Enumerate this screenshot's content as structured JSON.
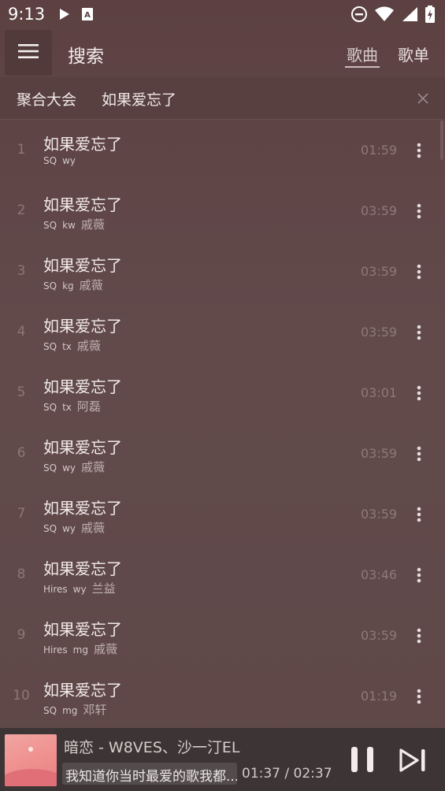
{
  "status_bar": {
    "time": "9:13",
    "icons": [
      "play-icon",
      "sim-card-a-icon",
      "do-not-disturb-icon",
      "wifi-icon",
      "signal-icon",
      "battery-charging-icon"
    ]
  },
  "header": {
    "title": "搜索",
    "tabs": [
      {
        "label": "歌曲",
        "active": true
      },
      {
        "label": "歌单",
        "active": false
      }
    ]
  },
  "search": {
    "source": "聚合大会",
    "query": "如果爱忘了"
  },
  "results": [
    {
      "index": "1",
      "title": "如果爱忘了",
      "quality": "SQ",
      "source": "wy",
      "artist": "",
      "duration": "01:59"
    },
    {
      "index": "2",
      "title": "如果爱忘了",
      "quality": "SQ",
      "source": "kw",
      "artist": "戚薇",
      "duration": "03:59"
    },
    {
      "index": "3",
      "title": "如果爱忘了",
      "quality": "SQ",
      "source": "kg",
      "artist": "戚薇",
      "duration": "03:59"
    },
    {
      "index": "4",
      "title": "如果爱忘了",
      "quality": "SQ",
      "source": "tx",
      "artist": "戚薇",
      "duration": "03:59"
    },
    {
      "index": "5",
      "title": "如果爱忘了",
      "quality": "SQ",
      "source": "tx",
      "artist": "阿磊",
      "duration": "03:01"
    },
    {
      "index": "6",
      "title": "如果爱忘了",
      "quality": "SQ",
      "source": "wy",
      "artist": "戚薇",
      "duration": "03:59"
    },
    {
      "index": "7",
      "title": "如果爱忘了",
      "quality": "SQ",
      "source": "wy",
      "artist": "戚薇",
      "duration": "03:59"
    },
    {
      "index": "8",
      "title": "如果爱忘了",
      "quality": "Hires",
      "source": "wy",
      "artist": "兰益",
      "duration": "03:46"
    },
    {
      "index": "9",
      "title": "如果爱忘了",
      "quality": "Hires",
      "source": "mg",
      "artist": "戚薇",
      "duration": "03:59"
    },
    {
      "index": "10",
      "title": "如果爱忘了",
      "quality": "SQ",
      "source": "mg",
      "artist": "邓轩",
      "duration": "01:19"
    }
  ],
  "player": {
    "title": "暗恋 - W8VES、沙一汀EL",
    "lyric": "我知道你当时最爱的歌我都...",
    "time": "01:37 / 02:37",
    "state": "playing"
  },
  "colors": {
    "background": "#5f4647",
    "player_bar": "#3c3435",
    "text_primary": "#f2eaea",
    "text_muted": "#8f7878"
  }
}
